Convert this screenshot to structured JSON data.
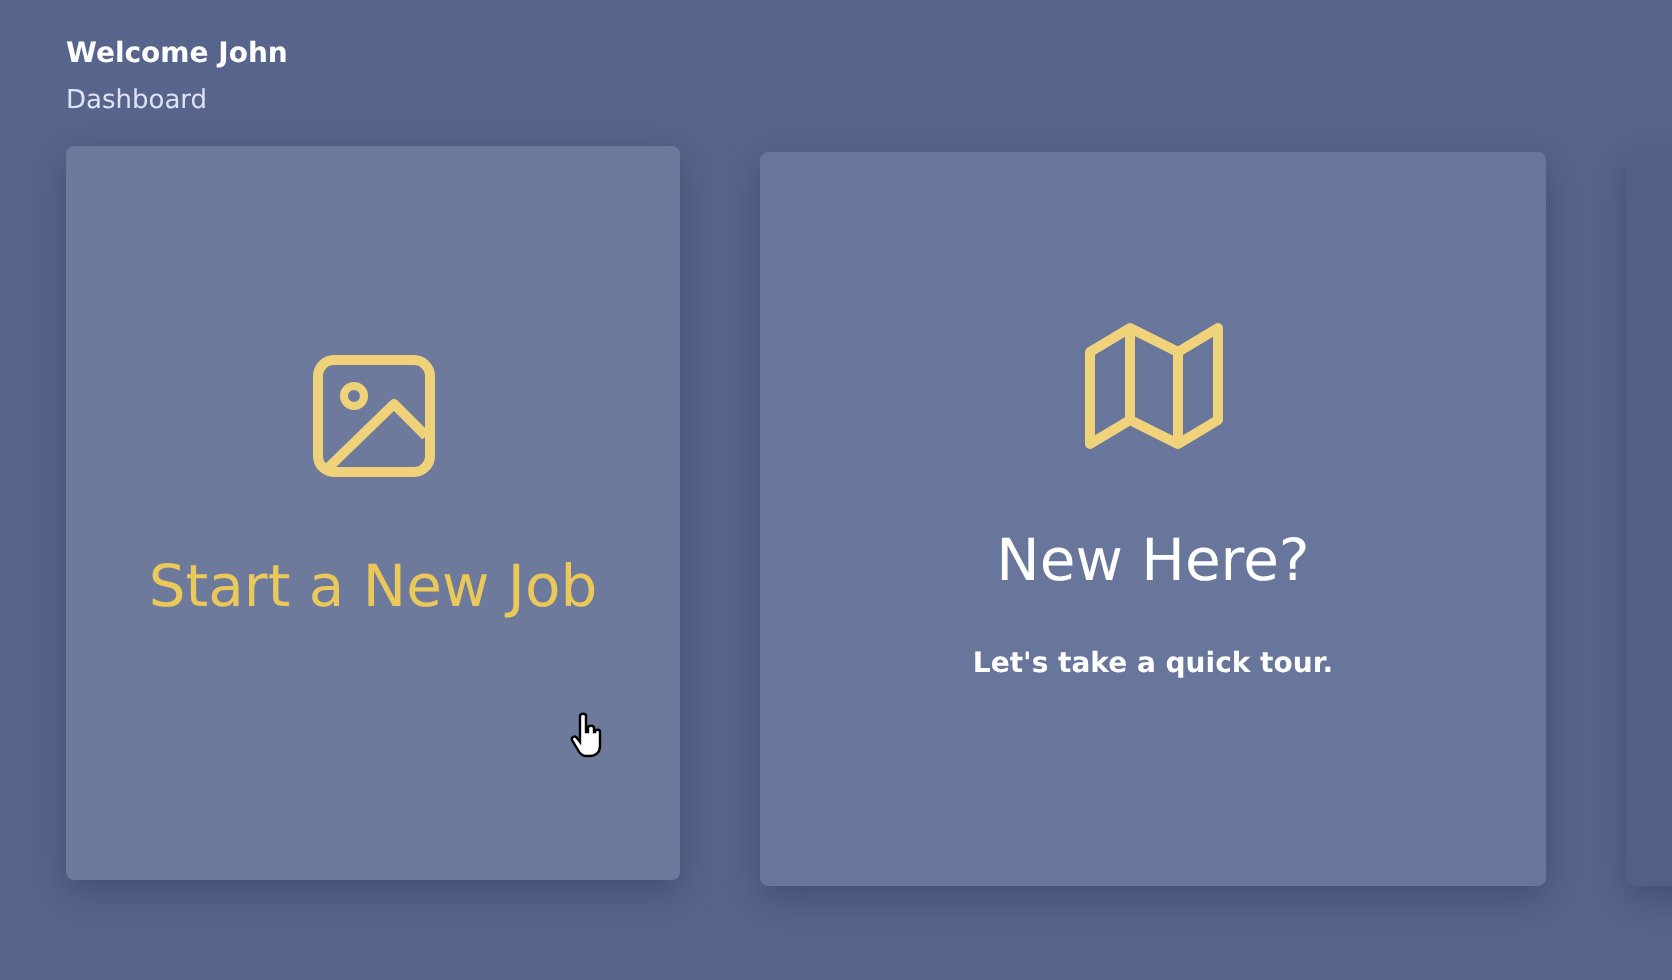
{
  "header": {
    "title": "Welcome John",
    "subtitle": "Dashboard"
  },
  "cards": [
    {
      "kind": "image",
      "title": "Start a New Job",
      "highlighted": true,
      "hovered": true
    },
    {
      "kind": "map",
      "title": "New Here?",
      "subtitle": "Let's take a quick tour.",
      "highlighted": false,
      "hovered": false
    },
    {
      "kind": "blank"
    }
  ]
}
